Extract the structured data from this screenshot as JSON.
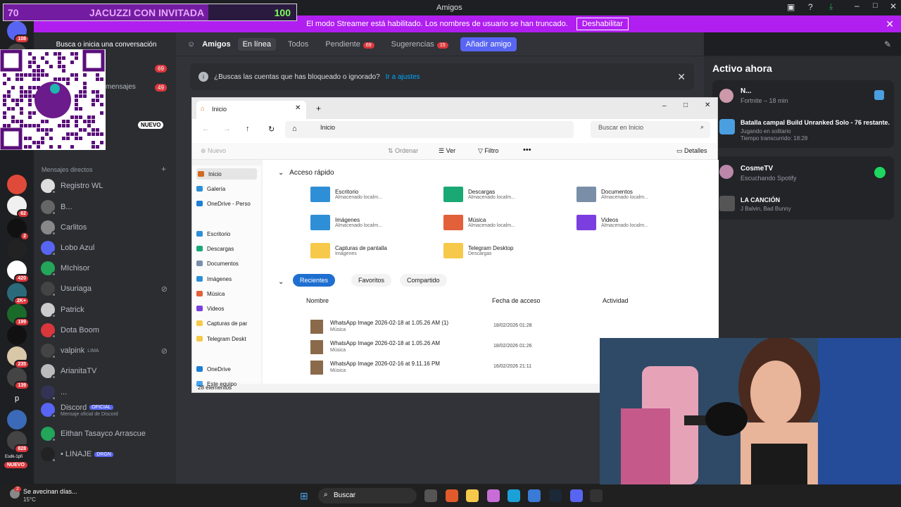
{
  "window": {
    "title": "Amigos"
  },
  "overlay": {
    "left": "70",
    "center": "JACUZZI CON INVITADA",
    "right": "100",
    "progress": 0.7
  },
  "banner": {
    "text": "El modo Streamer está habilitado. Los nombres de usuario se han truncado.",
    "button": "Deshabilitar"
  },
  "servers": {
    "badges": [
      "108",
      "62",
      "2",
      "420",
      "2K+",
      "199",
      "235",
      "139",
      "828"
    ],
    "p_label": "p",
    "nuevo": "NUEVO",
    "extra": "Esdk-1pfi"
  },
  "sidebar": {
    "search_placeholder": "Busca o inicia una conversación",
    "friends_badge": "69",
    "messages_partial": "mensajes",
    "messages_badge": "49",
    "nuevo_label": "NUEVO",
    "dm_header": "Mensajes directos",
    "dms": [
      {
        "name": "Registro WL",
        "sub": ""
      },
      {
        "name": "B...",
        "sub": ""
      },
      {
        "name": "Carlitos",
        "sub": ""
      },
      {
        "name": "Lobo Azul",
        "sub": ""
      },
      {
        "name": "MIchisor",
        "sub": ""
      },
      {
        "name": "Usuriaga",
        "sub": ""
      },
      {
        "name": "Patrick",
        "sub": ""
      },
      {
        "name": "Dota Boom",
        "sub": ""
      },
      {
        "name": "valpink",
        "sub": "LIMA"
      },
      {
        "name": "ArianitaTV",
        "sub": ""
      },
      {
        "name": "...",
        "sub": ""
      },
      {
        "name": "Discord",
        "sub": "Mensaje oficial de Discord",
        "tag": "OFICIAL"
      },
      {
        "name": "Eithan Tasayco Arrascue",
        "sub": ""
      },
      {
        "name": "• LINAJE",
        "sub": "",
        "tag": "DRGN"
      }
    ]
  },
  "tabs": {
    "friends": "Amigos",
    "online": "En línea",
    "all": "Todos",
    "pending": "Pendiente",
    "pending_count": "69",
    "suggestions": "Sugerencias",
    "suggestions_count": "15",
    "add_friend": "Añadir amigo"
  },
  "info": {
    "text": "¿Buscas las cuentas que has bloqueado o ignorado?",
    "link": "Ir a ajustes"
  },
  "active_now": {
    "title": "Activo ahora",
    "cards": [
      {
        "name": "N...",
        "status": "Fortnite – 18 min",
        "activity": "Batalla campal Build Unranked Solo - 76 restante...",
        "detail1": "Jugando en solitario",
        "detail2": "Tiempo transcurrido: 18:28"
      },
      {
        "name": "CosmeTV",
        "status": "Escuchando Spotify",
        "activity": "LA CANCIÓN",
        "detail1": "J Balvin, Bad Bunny"
      }
    ]
  },
  "explorer": {
    "tab_title": "Inicio",
    "path": "Inicio",
    "search_placeholder": "Buscar en Inicio",
    "toolbar": {
      "new": "Nuevo",
      "sort": "Ordenar",
      "view": "Ver",
      "filter": "Filtro",
      "details": "Detalles"
    },
    "nav": [
      "Inicio",
      "Galería",
      "OneDrive - Perso",
      "Escritorio",
      "Descargas",
      "Documentos",
      "Imágenes",
      "Música",
      "Videos",
      "Capturas de par",
      "Telegram Deskt",
      "OneDrive",
      "Este equipo"
    ],
    "quick_access_title": "Acceso rápido",
    "quick_access": [
      {
        "name": "Escritorio",
        "sub": "Almacenado localm...",
        "color": "#2f8fd6"
      },
      {
        "name": "Descargas",
        "sub": "Almacenado localm...",
        "color": "#1aa874"
      },
      {
        "name": "Documentos",
        "sub": "Almacenado localm...",
        "color": "#7a8ea8"
      },
      {
        "name": "Imágenes",
        "sub": "Almacenado localm...",
        "color": "#2f8fd6"
      },
      {
        "name": "Música",
        "sub": "Almacenado localm...",
        "color": "#e2603a"
      },
      {
        "name": "Videos",
        "sub": "Almacenado localm...",
        "color": "#7b3fe0"
      },
      {
        "name": "Capturas de pantalla",
        "sub": "Imágenes",
        "color": "#f6c94a"
      },
      {
        "name": "Telegram Desktop",
        "sub": "Descargas",
        "color": "#f6c94a"
      }
    ],
    "filters": [
      "Recientes",
      "Favoritos",
      "Compartido"
    ],
    "columns": [
      "Nombre",
      "Fecha de acceso",
      "Actividad"
    ],
    "files": [
      {
        "name": "WhatsApp Image 2026-02-18 at 1.05.26 AM (1)",
        "loc": "Música",
        "date": "18/02/2026 01:28"
      },
      {
        "name": "WhatsApp Image 2026-02-18 at 1.05.26 AM",
        "loc": "Música",
        "date": "18/02/2026 01:26"
      },
      {
        "name": "WhatsApp Image 2026-02-16 at 9.11.16 PM",
        "loc": "Música",
        "date": "16/02/2026 21:11"
      }
    ],
    "status": "28 elementos"
  },
  "taskbar": {
    "weather_title": "Se avecinan días...",
    "weather_temp": "15°C",
    "search": "Buscar",
    "notif": "2"
  },
  "colors": {
    "accent": "#5865f2",
    "streamer": "#b01ff0",
    "danger": "#da373c"
  }
}
